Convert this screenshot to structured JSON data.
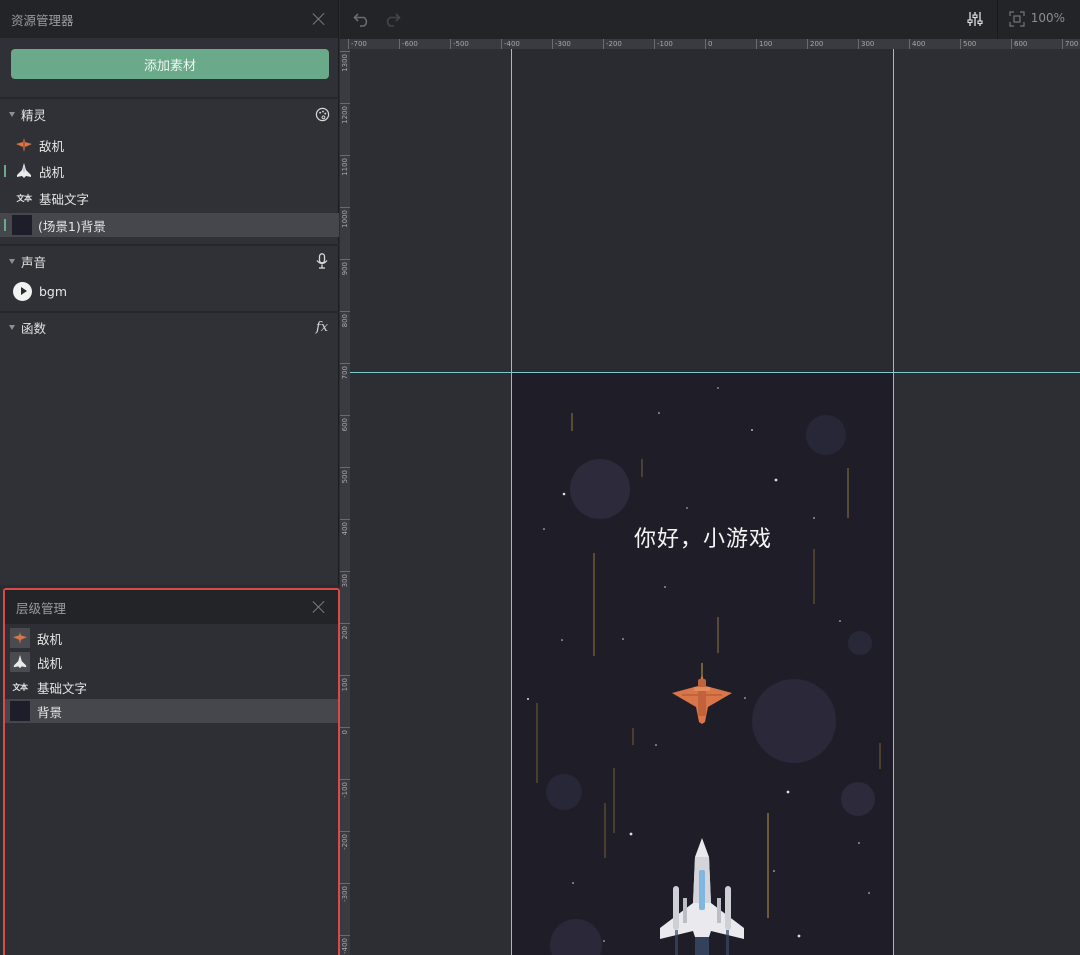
{
  "asset_panel": {
    "title": "资源管理器",
    "add_button": "添加素材",
    "sprites_section": {
      "title": "精灵",
      "icon": "palette-icon",
      "items": [
        {
          "label": "敌机",
          "icon": "enemy-plane-icon"
        },
        {
          "label": "战机",
          "icon": "fighter-plane-icon"
        },
        {
          "label": "基础文字",
          "icon": "text-icon",
          "icon_text": "文本"
        },
        {
          "label": "(场景1)背景",
          "icon": "background-thumb"
        }
      ]
    },
    "sound_section": {
      "title": "声音",
      "icon": "microphone-icon",
      "items": [
        {
          "label": "bgm",
          "icon": "play-icon"
        }
      ]
    },
    "function_section": {
      "title": "函数",
      "icon": "fx-icon",
      "icon_text": "fx"
    }
  },
  "layer_panel": {
    "title": "层级管理",
    "items": [
      {
        "label": "敌机"
      },
      {
        "label": "战机"
      },
      {
        "label": "基础文字",
        "icon_text": "文本"
      },
      {
        "label": "背景"
      }
    ]
  },
  "toolbar": {
    "undo_icon": "undo-icon",
    "redo_icon": "redo-icon",
    "settings_icon": "sliders-icon",
    "fit_icon": "fit-screen-icon",
    "zoom": "100%"
  },
  "ruler": {
    "top_labels": [
      "-700",
      "-600",
      "-500",
      "-400",
      "-300",
      "-200",
      "-100",
      "0",
      "100",
      "200",
      "300",
      "400",
      "500",
      "600",
      "700"
    ],
    "left_labels": [
      "1300",
      "1200",
      "1100",
      "1000",
      "900",
      "800",
      "700",
      "600",
      "500",
      "400",
      "300",
      "200",
      "100",
      "0",
      "-100",
      "-200",
      "-300",
      "-400"
    ]
  },
  "game": {
    "text": "你好，小游戏",
    "background_color": "#1f1e28",
    "guide_color": "#7cc9cf"
  },
  "colors": {
    "accent": "#6aa98a",
    "highlight_border": "#d94b4b"
  }
}
